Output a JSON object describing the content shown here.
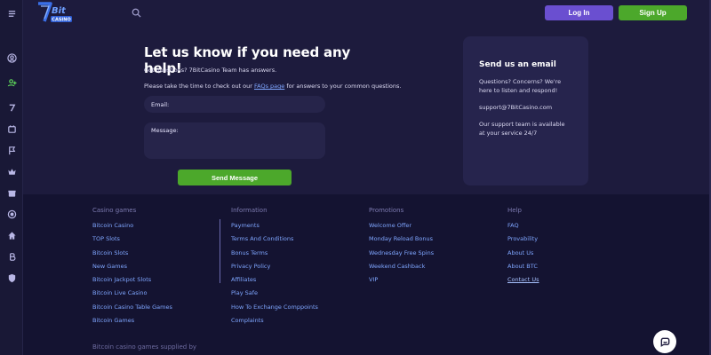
{
  "header": {
    "logo_text": "7Bit Casino",
    "login_label": "Log In",
    "signup_label": "Sign Up"
  },
  "sidebar": {
    "icons": [
      "menu-icon",
      "user-circle-icon",
      "user-plus-icon",
      "seven-icon",
      "slots-icon",
      "flag-icon",
      "crown-icon",
      "gift-icon",
      "dice-icon",
      "home-icon",
      "bitcoin-icon",
      "shield-icon"
    ]
  },
  "contact": {
    "heading": "Let us know if you need any help!",
    "intro": "Got questions? 7BitCasino Team has answers.",
    "faq_prefix": "Please take the time to check out our ",
    "faq_link": "FAQs page",
    "faq_suffix": " for answers to your common questions.",
    "email_placeholder": "Email:",
    "message_placeholder": "Message:",
    "send_label": "Send Message"
  },
  "email_card": {
    "title": "Send us an email",
    "text1": "Questions? Concerns? We're here to listen and respond!",
    "email": "support@7BitCasino.com",
    "text2": "Our support team is available at your service 24/7"
  },
  "footer": {
    "columns": [
      {
        "title": "Casino games",
        "items": [
          "Bitcoin Casino",
          "TOP Slots",
          "Bitcoin Slots",
          "New Games",
          "Bitcoin Jackpot Slots",
          "Bitcoin Live Casino",
          "Bitcoin Casino Table Games",
          "Bitcoin Games"
        ]
      },
      {
        "title": "Information",
        "items": [
          "Payments",
          "Terms And Conditions",
          "Bonus Terms",
          "Privacy Policy",
          "Affiliates",
          "Play Safe",
          "How To Exchange Comppoints",
          "Complaints"
        ]
      },
      {
        "title": "Promotions",
        "items": [
          "Welcome Offer",
          "Monday Reload Bonus",
          "Wednesday Free Spins",
          "Weekend Cashback",
          "VIP"
        ]
      },
      {
        "title": "Help",
        "items": [
          "FAQ",
          "Provability",
          "About Us",
          "About BTC",
          "Contact Us"
        ]
      }
    ],
    "supplied_text": "Bitcoin casino games supplied by"
  },
  "colors": {
    "background": "#1d1b3d",
    "footer": "#141331",
    "login": "#6a4fd0",
    "signup": "#4ca82b",
    "link": "#7fa6ff"
  }
}
